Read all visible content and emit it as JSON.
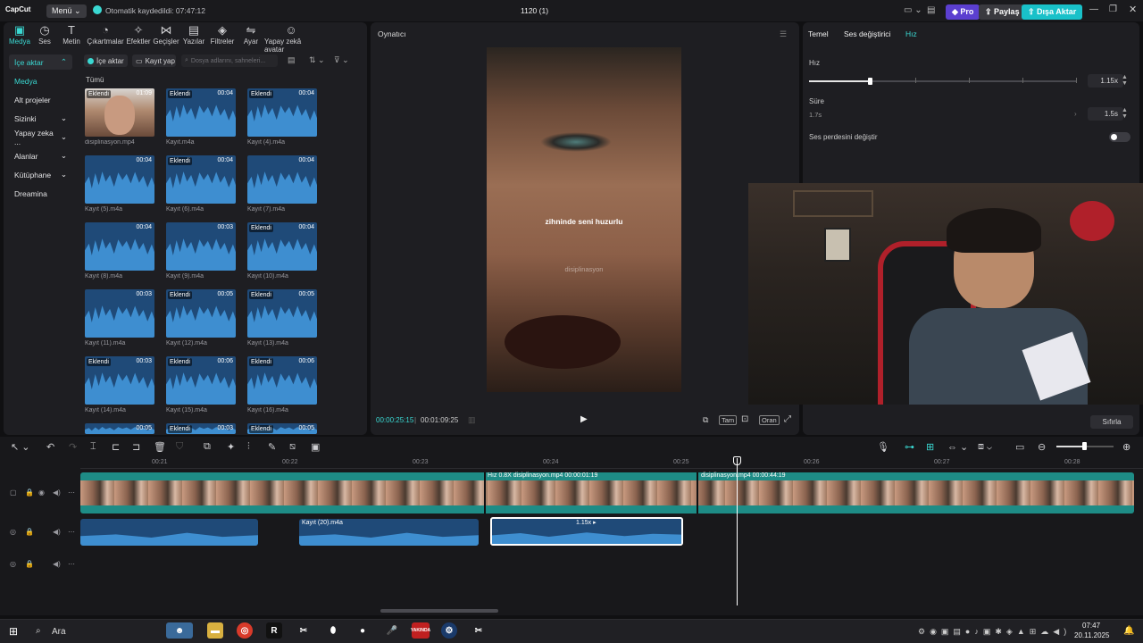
{
  "app": {
    "logo": "CapCut",
    "menu_label": "Menü",
    "autosave": "Otomatik kaydedildi: 07:47:12",
    "project_title": "1120 (1)",
    "pro_label": "Pro",
    "share_label": "Paylaş",
    "export_label": "Dışa Aktar"
  },
  "toolbar": {
    "items": [
      {
        "icon": "media-icon",
        "glyph": "▣",
        "label": "Medya"
      },
      {
        "icon": "audio-icon",
        "glyph": "◷",
        "label": "Ses"
      },
      {
        "icon": "text-icon",
        "glyph": "T",
        "label": "Metin"
      },
      {
        "icon": "sticker-icon",
        "glyph": "◔",
        "label": "Çıkartmalar"
      },
      {
        "icon": "effects-icon",
        "glyph": "✧",
        "label": "Efektler"
      },
      {
        "icon": "transitions-icon",
        "glyph": "⋈",
        "label": "Geçişler"
      },
      {
        "icon": "captions-icon",
        "glyph": "▤",
        "label": "Yazılar"
      },
      {
        "icon": "filters-icon",
        "glyph": "◈",
        "label": "Filtreler"
      },
      {
        "icon": "adjust-icon",
        "glyph": "⇋",
        "label": "Ayar"
      },
      {
        "icon": "ai-avatar-icon",
        "glyph": "☺",
        "label": "Yapay zekâ avatar"
      }
    ]
  },
  "sidebar": {
    "items": [
      {
        "label": "İçe aktar",
        "chevron": "⌃"
      },
      {
        "label": "Medya",
        "chevron": ""
      },
      {
        "label": "Alt projeler",
        "chevron": ""
      },
      {
        "label": "Sizinki",
        "chevron": "⌄"
      },
      {
        "label": "Yapay zeka ...",
        "chevron": "⌄"
      },
      {
        "label": "Alanlar",
        "chevron": "⌄"
      },
      {
        "label": "Kütüphane",
        "chevron": "⌄"
      },
      {
        "label": "Dreamina",
        "chevron": ""
      }
    ]
  },
  "media": {
    "import_label": "İçe aktar",
    "record_label": "Kayıt yap",
    "search_placeholder": "Dosya adlarını, sahneleri...",
    "section_label": "Tümü",
    "items": [
      {
        "name": "disiplinasyon.mp4",
        "tag": "Eklendi",
        "duration": "01:09",
        "kind": "video"
      },
      {
        "name": "Kayıt.m4a",
        "tag": "Eklendi",
        "duration": "00:04",
        "kind": "audio"
      },
      {
        "name": "Kayıt (4).m4a",
        "tag": "Eklendi",
        "duration": "00:04",
        "kind": "audio"
      },
      {
        "name": "Kayıt (5).m4a",
        "tag": "",
        "duration": "00:04",
        "kind": "audio"
      },
      {
        "name": "Kayıt (6).m4a",
        "tag": "Eklendi",
        "duration": "00:04",
        "kind": "audio"
      },
      {
        "name": "Kayıt (7).m4a",
        "tag": "",
        "duration": "00:04",
        "kind": "audio"
      },
      {
        "name": "Kayıt (8).m4a",
        "tag": "",
        "duration": "00:04",
        "kind": "audio"
      },
      {
        "name": "Kayıt (9).m4a",
        "tag": "",
        "duration": "00:03",
        "kind": "audio"
      },
      {
        "name": "Kayıt (10).m4a",
        "tag": "Eklendi",
        "duration": "00:04",
        "kind": "audio"
      },
      {
        "name": "Kayıt (11).m4a",
        "tag": "",
        "duration": "00:03",
        "kind": "audio"
      },
      {
        "name": "Kayıt (12).m4a",
        "tag": "Eklendi",
        "duration": "00:05",
        "kind": "audio"
      },
      {
        "name": "Kayıt (13).m4a",
        "tag": "Eklendi",
        "duration": "00:05",
        "kind": "audio"
      },
      {
        "name": "Kayıt (14).m4a",
        "tag": "Eklendi",
        "duration": "00:03",
        "kind": "audio"
      },
      {
        "name": "Kayıt (15).m4a",
        "tag": "Eklendi",
        "duration": "00:06",
        "kind": "audio"
      },
      {
        "name": "Kayıt (16).m4a",
        "tag": "Eklendi",
        "duration": "00:06",
        "kind": "audio"
      },
      {
        "name": "",
        "tag": "",
        "duration": "00:05",
        "kind": "audio"
      },
      {
        "name": "",
        "tag": "Eklendi",
        "duration": "00:03",
        "kind": "audio"
      },
      {
        "name": "",
        "tag": "Eklendi",
        "duration": "00:05",
        "kind": "audio"
      }
    ]
  },
  "player": {
    "title": "Oynatıcı",
    "subtitle_text": "zihninde seni huzurlu",
    "watermark": "disiplinasyon",
    "current_time": "00:00:25:15",
    "total_time": "00:01:09:25",
    "full_label": "Tam",
    "ratio_label": "Oran"
  },
  "inspector": {
    "tabs": [
      "Temel",
      "Ses değiştirici",
      "Hız"
    ],
    "active_tab": "Hız",
    "speed_label": "Hız",
    "speed_value": "1.15x",
    "speed_fraction": 0.35,
    "duration_label": "Süre",
    "duration_original": "1.7s",
    "duration_value": "1.5s",
    "pitch_label": "Ses perdesini değiştir",
    "pitch_enabled": false,
    "reset_label": "Sıfırla"
  },
  "timeline": {
    "ruler": [
      "00:21",
      "00:22",
      "00:23",
      "00:24",
      "00:25",
      "00:26",
      "00:27",
      "00:28"
    ],
    "video_clip_a_label": "Hız 0.8X  disiplinasyon.mp4  00:00:01:19",
    "video_clip_b_label": "disiplinasyon.mp4  00:00:44:19",
    "audio_clip_label": "Kayıt (20).m4a",
    "selected_speed_label": "1.15x ▸"
  },
  "taskbar": {
    "search_label": "Ara",
    "time": "07:47",
    "date": "20.11.2025",
    "steam_badge": "YAKINDA"
  },
  "colors": {
    "accent": "#3ad8d2",
    "export": "#19c1c9",
    "pro": "#5b3fd0",
    "audio_clip": "#1f4a78",
    "video_track": "#1e8c86"
  }
}
